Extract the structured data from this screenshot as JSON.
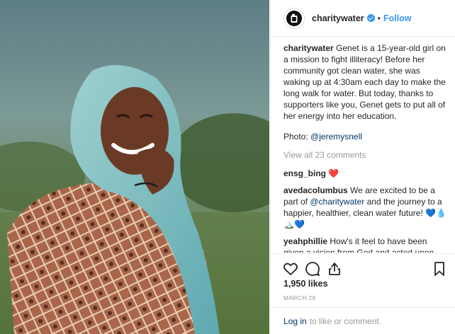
{
  "post": {
    "username": "charitywater",
    "separator": "•",
    "follow_label": "Follow",
    "caption": {
      "username": "charitywater",
      "text": "Genet is a 15-year-old girl on a mission to fight illiteracy! Before her community got clean water, she was waking up at 4:30am each day to make the long walk for water. But today, thanks to supporters like you, Genet gets to put all of her energy into her education."
    },
    "photo_credit": {
      "label": "Photo:",
      "handle": "@jeremysnell"
    },
    "view_all": "View all 23 comments",
    "comments": [
      {
        "username": "ensg_bing",
        "text": "❤️"
      },
      {
        "username": "avedacolumbus",
        "text_before": "We are excited to be a part of",
        "mention": "@charitywater",
        "text_after": "and the journey to a happier, healthier, clean water future! 💙💧🏔️💙"
      },
      {
        "username": "yeahphillie",
        "text": "How's it feel to have been given a vision from God and acted upon the call an now millions of people drink clean water because of it, an how many of these millions are now faithful to the gospel..."
      }
    ],
    "likes": "1,950 likes",
    "date": "MARCH 29",
    "login_label": "Log in",
    "login_suffix": "to like or comment."
  },
  "icons": {
    "avatar": "charity-water-jerrycan-logo",
    "verified": "verified-badge",
    "like": "heart-outline-icon",
    "comment": "speech-bubble-icon",
    "share": "share-upload-icon",
    "save": "bookmark-icon"
  },
  "colors": {
    "link": "#3897f0",
    "mention": "#003569",
    "muted": "#999999",
    "text": "#262626"
  }
}
